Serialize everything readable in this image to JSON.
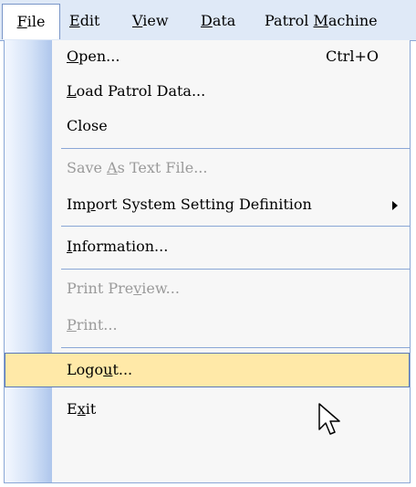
{
  "menubar": {
    "file": {
      "pre": "",
      "u": "F",
      "post": "ile"
    },
    "edit": {
      "pre": "",
      "u": "E",
      "post": "dit"
    },
    "view": {
      "pre": "",
      "u": "V",
      "post": "iew"
    },
    "data": {
      "pre": "",
      "u": "D",
      "post": "ata"
    },
    "patrol": {
      "pre": "Patrol ",
      "u": "M",
      "post": "achine"
    }
  },
  "file_menu": {
    "open": {
      "pre": "",
      "u": "O",
      "post": "pen...",
      "shortcut": "Ctrl+O"
    },
    "load": {
      "pre": "",
      "u": "L",
      "post": "oad Patrol Data..."
    },
    "close": {
      "pre": "Close",
      "u": "",
      "post": ""
    },
    "save_text": {
      "pre": "Save ",
      "u": "A",
      "post": "s Text File..."
    },
    "import": {
      "pre": "Im",
      "u": "p",
      "post": "ort System Setting Definition"
    },
    "information": {
      "pre": "",
      "u": "I",
      "post": "nformation..."
    },
    "print_preview": {
      "pre": "Print Pre",
      "u": "v",
      "post": "iew..."
    },
    "print": {
      "pre": "",
      "u": "P",
      "post": "rint..."
    },
    "logout": {
      "pre": "Logo",
      "u": "u",
      "post": "t..."
    },
    "exit": {
      "pre": "E",
      "u": "x",
      "post": "it"
    }
  },
  "colors": {
    "menubar_bg": "#dfe9f7",
    "hover_bg": "#ffe9a8",
    "hover_border": "#5a79b8",
    "separator": "#8aa7d6",
    "disabled_text": "#9a9a9a"
  },
  "icons": {
    "submenu": "triangle-right-icon",
    "pointer": "mouse-pointer-icon"
  }
}
